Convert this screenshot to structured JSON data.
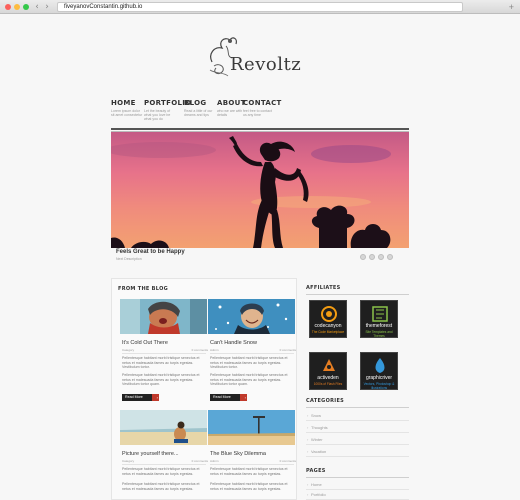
{
  "browser": {
    "url": "fiveyanovConstantin.github.io"
  },
  "logo": {
    "text": "Revoltz"
  },
  "nav": [
    {
      "label": "HOME",
      "sub": "Lorem ipsum dolor sit amet consectetur"
    },
    {
      "label": "PORTFOLIO",
      "sub": "Let the beauty of what you love be what you do"
    },
    {
      "label": "BLOG",
      "sub": "Read a little of our dreams and tips"
    },
    {
      "label": "ABOUT",
      "sub": "who we are with details"
    },
    {
      "label": "CONTACT",
      "sub": "feel free to contact us any time"
    }
  ],
  "hero": {
    "caption": "Feels Great to be Happy",
    "caption_sub": "Next Description"
  },
  "blog": {
    "heading": "FROM THE BLOG",
    "posts": [
      {
        "title": "It's Cold Out There",
        "meta_left": "Category",
        "meta_right": "0 comments",
        "text": "Pellentesque habitant morbi tristique senectus et netus et malesuada fames ac turpis egestas. Vestibulum tortor.",
        "text2": "Pellentesque habitant morbi tristique senectus et netus et malesuada fames ac turpis egestas. Vestibulum tortor quam.",
        "button": "Read More"
      },
      {
        "title": "Can't Handle Snow",
        "meta_left": "Admin",
        "meta_right": "0 comments",
        "text": "Pellentesque habitant morbi tristique senectus et netus et malesuada fames ac turpis egestas. Vestibulum tortor.",
        "text2": "Pellentesque habitant morbi tristique senectus et netus et malesuada fames ac turpis egestas. Vestibulum tortor quam.",
        "button": "Read More"
      },
      {
        "title": "Picture yourself there...",
        "meta_left": "Category",
        "meta_right": "0 comments",
        "text": "Pellentesque habitant morbi tristique senectus et netus et malesuada fames ac turpis egestas.",
        "text2": "Pellentesque habitant morbi tristique senectus et netus et malesuada fames ac turpis egestas."
      },
      {
        "title": "The Blue Sky Dilemma",
        "meta_left": "Admin",
        "meta_right": "0 comments",
        "text": "Pellentesque habitant morbi tristique senectus et netus et malesuada fames ac turpis egestas.",
        "text2": "Pellentesque habitant morbi tristique senectus et netus et malesuada fames ac turpis egestas."
      }
    ]
  },
  "sidebar": {
    "affiliates_heading": "AFFILIATES",
    "affiliates": [
      {
        "name": "codecanyon",
        "sub": "The Code Marketplace",
        "color": "#f39c12"
      },
      {
        "name": "themeforest",
        "sub": "Site Templates and Themes",
        "color": "#8bc34a"
      },
      {
        "name": "activeden",
        "sub": "1000s of Flash Files",
        "color": "#e67e22"
      },
      {
        "name": "graphicriver",
        "sub": "Vectors, Photoshop & Illustrations",
        "color": "#3498db"
      }
    ],
    "categories_heading": "CATEGORIES",
    "categories": [
      "Snow",
      "Thoughts",
      "Winter",
      "Vacation"
    ],
    "pages_heading": "PAGES",
    "pages": [
      "Home",
      "Portfolio"
    ]
  }
}
